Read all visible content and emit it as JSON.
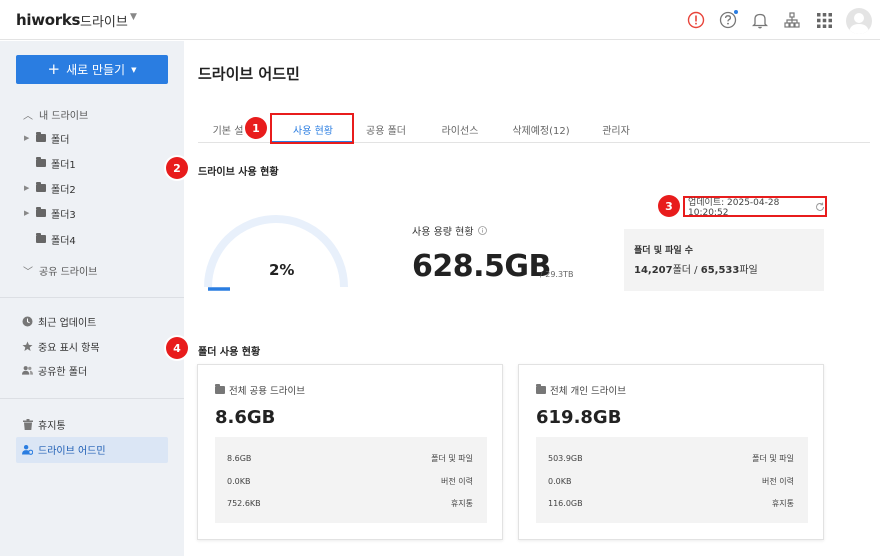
{
  "topbar": {
    "logo": "hiworks",
    "app_name": "드라이브",
    "icons": [
      "alert-icon",
      "help-icon",
      "bell-icon",
      "org-chart-icon",
      "apps-grid-icon",
      "user-avatar-icon"
    ]
  },
  "sidebar": {
    "new_button": "새로 만들기",
    "my_drive": "내 드라이브",
    "folders": [
      {
        "label": "폴더",
        "expandable": true
      },
      {
        "label": "폴더1",
        "expandable": false
      },
      {
        "label": "폴더2",
        "expandable": true
      },
      {
        "label": "폴더3",
        "expandable": true
      },
      {
        "label": "폴더4",
        "expandable": false
      }
    ],
    "shared_drive": "공유 드라이브",
    "recent": "최근 업데이트",
    "starred": "중요 표시 항목",
    "shared_folder": "공유한 폴더",
    "trash": "휴지통",
    "drive_admin": "드라이브 어드민"
  },
  "main": {
    "title": "드라이브 어드민",
    "tabs": [
      "기본 설",
      "사용 현황",
      "공용 폴더",
      "라이선스",
      "삭제예정(12)",
      "관리자"
    ],
    "active_tab_index": 1,
    "usage_section_title": "드라이브 사용 현황",
    "update_label": "업데이트: 2025-04-28 10:20:52",
    "gauge_percent": "2%",
    "gauge_fraction": 0.02,
    "usage_label": "사용 용량 현황",
    "usage_value": "628.5GB",
    "usage_total": "/ 29.3TB",
    "file_count_label": "폴더 및 파일 수",
    "folder_count": "14,207",
    "folder_unit": "폴더",
    "file_sep": " / ",
    "file_count": "65,533",
    "file_unit": "파일",
    "folder_section_title": "폴더 사용 현황"
  },
  "cards": [
    {
      "title": "전체 공용 드라이브",
      "total": "8.6GB",
      "rows": [
        {
          "value": "8.6GB",
          "label": "폴더 및 파일"
        },
        {
          "value": "0.0KB",
          "label": "버전 이력"
        },
        {
          "value": "752.6KB",
          "label": "휴지통"
        }
      ]
    },
    {
      "title": "전체 개인 드라이브",
      "total": "619.8GB",
      "rows": [
        {
          "value": "503.9GB",
          "label": "폴더 및 파일"
        },
        {
          "value": "0.0KB",
          "label": "버전 이력"
        },
        {
          "value": "116.0GB",
          "label": "휴지통"
        }
      ]
    }
  ],
  "annotations": {
    "badges": [
      "1",
      "2",
      "3",
      "4"
    ]
  },
  "colors": {
    "accent": "#2a7de1",
    "highlight": "#e81c1c",
    "sidebar_bg": "#eef1f5",
    "gauge_track": "#e8f0fb"
  }
}
